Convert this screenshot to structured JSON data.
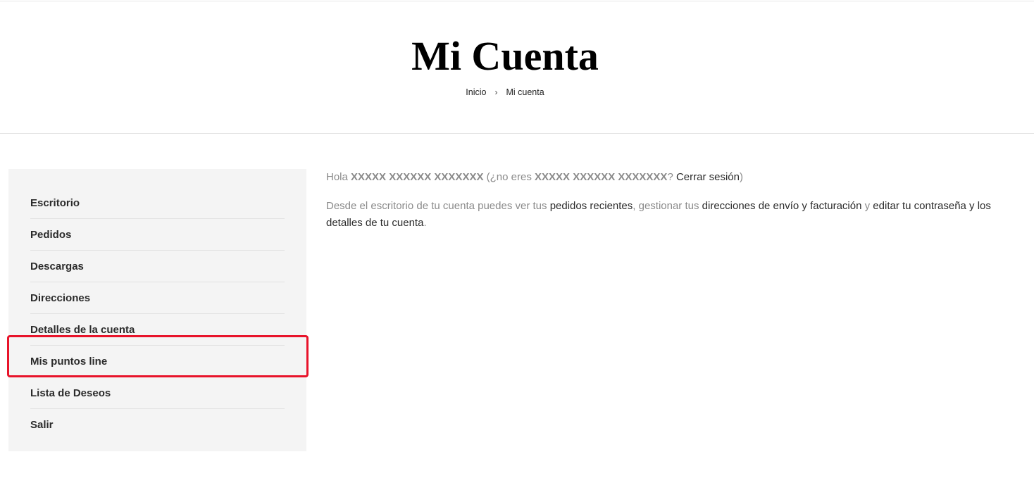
{
  "header": {
    "title": "Mi Cuenta",
    "breadcrumb": {
      "home": "Inicio",
      "separator": "›",
      "current": "Mi cuenta"
    }
  },
  "sidebar": {
    "items": [
      {
        "label": "Escritorio"
      },
      {
        "label": "Pedidos"
      },
      {
        "label": "Descargas"
      },
      {
        "label": "Direcciones"
      },
      {
        "label": "Detalles de la cuenta"
      },
      {
        "label": "Mis puntos line"
      },
      {
        "label": "Lista de Deseos"
      },
      {
        "label": "Salir"
      }
    ]
  },
  "content": {
    "greeting_hello": "Hola ",
    "user_name": "XXXXX XXXXXX XXXXXXX",
    "greeting_not_you": " (¿no eres ",
    "user_name_again": "XXXXX XXXXXX XXXXXXX",
    "greeting_q": "? ",
    "logout_link": "Cerrar sesión",
    "greeting_close": ")",
    "desc_1": "Desde el escritorio de tu cuenta puedes ver tus ",
    "link_orders": "pedidos recientes",
    "desc_2": ", gestionar tus ",
    "link_addresses": "direcciones de envío y facturación",
    "desc_3": " y ",
    "link_password": "editar tu contraseña y los detalles de tu cuenta",
    "desc_4": "."
  },
  "colors": {
    "highlight": "#e8132a",
    "sidebar_bg": "#f4f4f4"
  }
}
